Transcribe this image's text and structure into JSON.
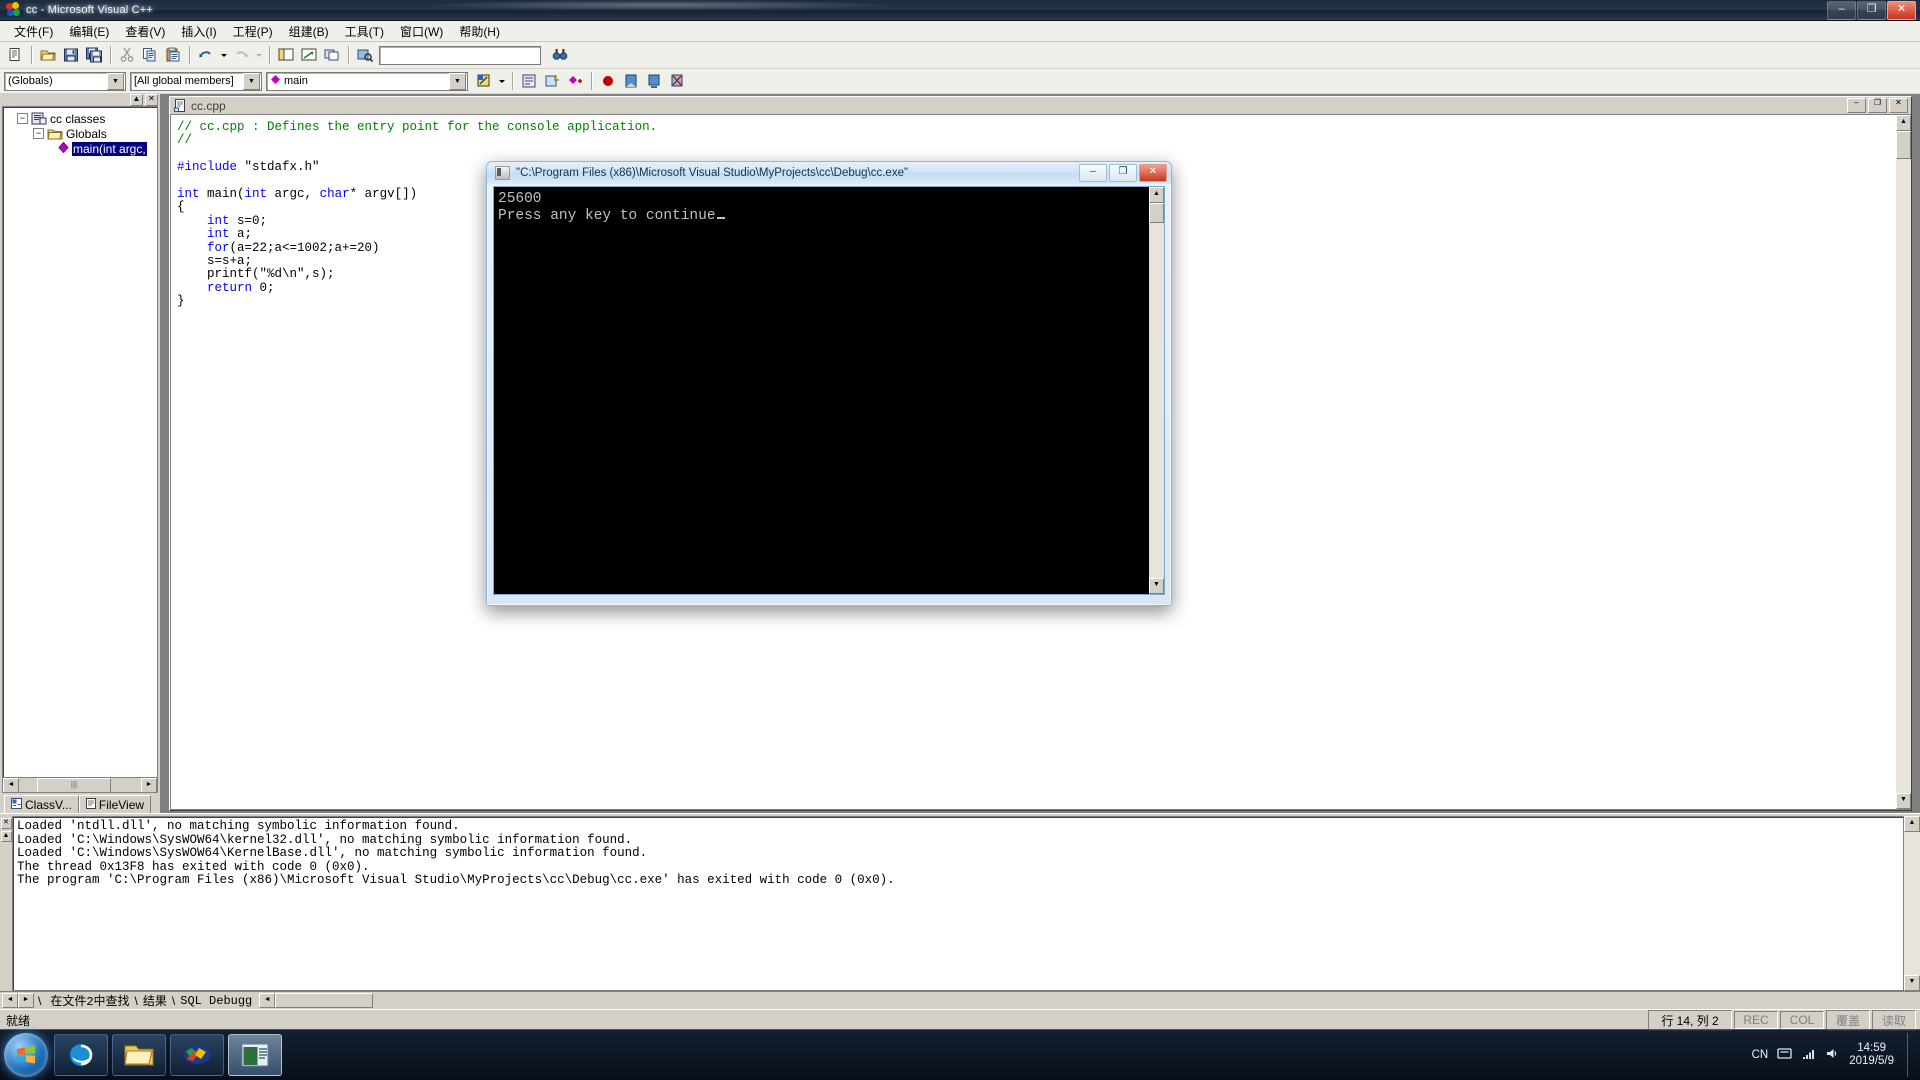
{
  "window": {
    "title": "cc - Microsoft Visual C++",
    "minimize_label": "–",
    "maximize_label": "❐",
    "close_label": "✕"
  },
  "menubar": {
    "items": [
      {
        "label": "文件(F)"
      },
      {
        "label": "编辑(E)"
      },
      {
        "label": "查看(V)"
      },
      {
        "label": "插入(I)"
      },
      {
        "label": "工程(P)"
      },
      {
        "label": "组建(B)"
      },
      {
        "label": "工具(T)"
      },
      {
        "label": "窗口(W)"
      },
      {
        "label": "帮助(H)"
      }
    ]
  },
  "toolbar": {
    "find_box_value": "",
    "icons": [
      "new-file-icon",
      "open-folder-icon",
      "save-icon",
      "save-all-icon",
      "cut-icon",
      "copy-icon",
      "paste-icon",
      "undo-icon",
      "undo-dropdown-icon",
      "redo-icon",
      "redo-dropdown-icon",
      "workspace-icon",
      "output-window-icon",
      "window-list-icon",
      "find-in-files-icon",
      "find-binoculars-icon"
    ]
  },
  "wizardbar": {
    "scope_combo": "(Globals)",
    "members_combo": "[All global members]",
    "symbol_combo": "main",
    "icons": [
      "goto-definition-icon",
      "dropdown-icon",
      "class-wizard-icon",
      "new-class-icon",
      "new-member-icon",
      "breakpoint-icon",
      "toggle-bookmark-icon",
      "next-bookmark-icon",
      "clear-bookmark-icon"
    ]
  },
  "workspace": {
    "tree": [
      {
        "label": "cc classes",
        "icon": "classes-icon",
        "expander": "−",
        "depth": 0,
        "selected": false
      },
      {
        "label": "Globals",
        "icon": "folder-icon",
        "expander": "−",
        "depth": 1,
        "selected": false
      },
      {
        "label": "main(int argc,",
        "icon": "member-diamond-icon",
        "expander": "",
        "depth": 2,
        "selected": true
      }
    ],
    "tabs": [
      {
        "label": "ClassV...",
        "icon": "classview-icon",
        "active": true
      },
      {
        "label": "FileView",
        "icon": "fileview-icon",
        "active": false
      }
    ]
  },
  "editor": {
    "tab_title": "cc.cpp",
    "minimize_label": "–",
    "restore_label": "❐",
    "close_label": "✕",
    "lines": [
      [
        {
          "t": "// cc.cpp : Defines the entry point for the console application.",
          "c": "cm"
        }
      ],
      [
        {
          "t": "//",
          "c": "cm"
        }
      ],
      [],
      [
        {
          "t": "#include ",
          "c": "pp"
        },
        {
          "t": "\"stdafx.h\"",
          "c": "st"
        }
      ],
      [],
      [
        {
          "t": "int",
          "c": "kw"
        },
        {
          "t": " main(",
          "c": "st"
        },
        {
          "t": "int",
          "c": "kw"
        },
        {
          "t": " argc, ",
          "c": "st"
        },
        {
          "t": "char",
          "c": "kw"
        },
        {
          "t": "* argv[])",
          "c": "st"
        }
      ],
      [
        {
          "t": "{",
          "c": "st"
        }
      ],
      [
        {
          "t": "    ",
          "c": "st"
        },
        {
          "t": "int",
          "c": "kw"
        },
        {
          "t": " s=0;",
          "c": "st"
        }
      ],
      [
        {
          "t": "    ",
          "c": "st"
        },
        {
          "t": "int",
          "c": "kw"
        },
        {
          "t": " a;",
          "c": "st"
        }
      ],
      [
        {
          "t": "    ",
          "c": "st"
        },
        {
          "t": "for",
          "c": "kw"
        },
        {
          "t": "(a=22;a<=1002;a+=20)",
          "c": "st"
        }
      ],
      [
        {
          "t": "    s=s+a;",
          "c": "st"
        }
      ],
      [
        {
          "t": "    printf(\"%d\\n\",s);",
          "c": "st"
        }
      ],
      [
        {
          "t": "    ",
          "c": "st"
        },
        {
          "t": "return",
          "c": "kw"
        },
        {
          "t": " 0;",
          "c": "st"
        }
      ],
      [
        {
          "t": "}",
          "c": "st"
        }
      ]
    ]
  },
  "output": {
    "lines": [
      "Loaded 'ntdll.dll', no matching symbolic information found.",
      "Loaded 'C:\\Windows\\SysWOW64\\kernel32.dll', no matching symbolic information found.",
      "Loaded 'C:\\Windows\\SysWOW64\\KernelBase.dll', no matching symbolic information found.",
      "The thread 0x13F8 has exited with code 0 (0x0).",
      "The program 'C:\\Program Files (x86)\\Microsoft Visual Studio\\MyProjects\\cc\\Debug\\cc.exe' has exited with code 0 (0x0)."
    ],
    "tabs": [
      {
        "label": "在文件2中查找"
      },
      {
        "label": "结果"
      },
      {
        "label": "SQL Debugg"
      }
    ]
  },
  "statusbar": {
    "message": "就绪",
    "position": "行 14, 列 2",
    "indicators": [
      {
        "label": "REC",
        "lit": false
      },
      {
        "label": "COL",
        "lit": false
      },
      {
        "label": "覆盖",
        "lit": false
      },
      {
        "label": "读取",
        "lit": false
      }
    ]
  },
  "console": {
    "title": "\"C:\\Program Files (x86)\\Microsoft Visual Studio\\MyProjects\\cc\\Debug\\cc.exe\"",
    "minimize_label": "–",
    "maximize_label": "❐",
    "close_label": "✕",
    "output_lines": [
      "25600",
      "Press any key to continue"
    ]
  },
  "taskbar": {
    "start_label": "start-orb",
    "items": [
      {
        "name": "internet-explorer-icon",
        "active": false
      },
      {
        "name": "windows-explorer-icon",
        "active": false
      },
      {
        "name": "visual-cpp-icon",
        "active": false
      },
      {
        "name": "active-window-icon",
        "active": true
      }
    ],
    "tray": {
      "ime": "CN",
      "time": "14:59",
      "date": "2019/5/9"
    }
  },
  "colors": {
    "comment_green": "#008000",
    "keyword_blue": "#0000ff",
    "selection_navy": "#000080",
    "chrome_gray": "#d4d0c8",
    "console_black": "#000000"
  }
}
